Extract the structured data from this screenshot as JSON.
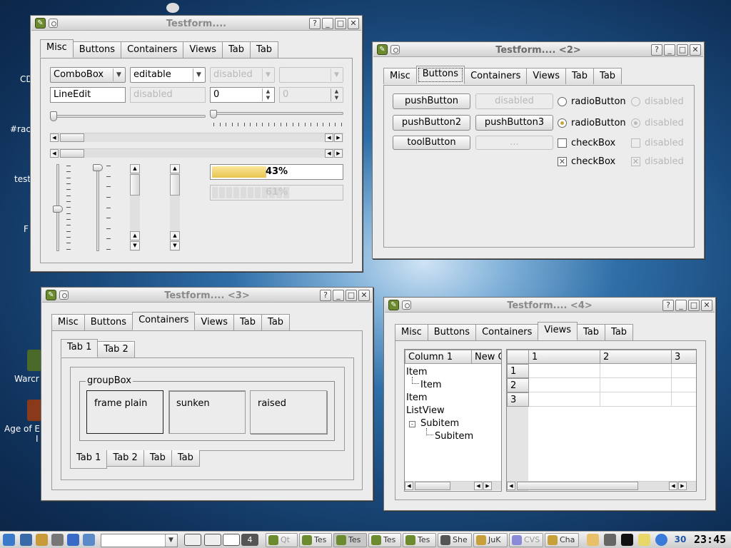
{
  "colors": {
    "desktop": "#1a4a7c",
    "progress": "#e9c44e"
  },
  "desktop_icons": [
    {
      "label": "CD"
    },
    {
      "label": "#rac"
    },
    {
      "label": "test"
    },
    {
      "label": "F"
    },
    {
      "label": "Warcr"
    },
    {
      "label": "Age of E"
    },
    {
      "label": "I"
    }
  ],
  "win1": {
    "title": "Testform....",
    "tabs": [
      "Misc",
      "Buttons",
      "Containers",
      "Views",
      "Tab",
      "Tab"
    ],
    "combo1": "ComboBox",
    "combo2": "editable",
    "combo3": "disabled",
    "combo4": "",
    "lineedit": "LineEdit",
    "lineedit_dis": "disabled",
    "spin1": "0",
    "spin2": "0",
    "progress1": {
      "label": "43%",
      "value": 43
    },
    "progress2": {
      "label": "61%",
      "value": 61
    }
  },
  "win2": {
    "title": "Testform.... <2>",
    "tabs": [
      "Misc",
      "Buttons",
      "Containers",
      "Views",
      "Tab",
      "Tab"
    ],
    "push1": "pushButton",
    "push1_dis": "disabled",
    "push2": "pushButton2",
    "push3": "pushButton3",
    "tool": "toolButton",
    "tool_dis": "...",
    "radio1": "radioButton",
    "radio1_dis": "disabled",
    "radio2": "radioButton",
    "radio2_dis": "disabled",
    "check1": "checkBox",
    "check1_dis": "disabled",
    "check2": "checkBox",
    "check2_dis": "disabled"
  },
  "win3": {
    "title": "Testform.... <3>",
    "tabs": [
      "Misc",
      "Buttons",
      "Containers",
      "Views",
      "Tab",
      "Tab"
    ],
    "inner_tabs": [
      "Tab 1",
      "Tab 2"
    ],
    "groupbox": "groupBox",
    "frames": [
      "frame plain",
      "sunken",
      "raised"
    ],
    "bottom_tabs": [
      "Tab 1",
      "Tab 2",
      "Tab",
      "Tab"
    ]
  },
  "win4": {
    "title": "Testform.... <4>",
    "tabs": [
      "Misc",
      "Buttons",
      "Containers",
      "Views",
      "Tab",
      "Tab"
    ],
    "listview": {
      "columns": [
        "Column 1",
        "New C"
      ],
      "items": [
        "Item",
        "Item",
        "Item",
        "ListView",
        "Subitem",
        "Subitem"
      ]
    },
    "table": {
      "col_headers": [
        "1",
        "2",
        "3"
      ],
      "row_headers": [
        "1",
        "2",
        "3"
      ]
    }
  },
  "taskbar": {
    "desktop_num": "4",
    "tasks": [
      "Qt",
      "Tes",
      "Tes",
      "Tes",
      "Tes",
      "She",
      "JuK",
      "CVS",
      "Cha"
    ],
    "date": "30",
    "clock": "23:45"
  }
}
